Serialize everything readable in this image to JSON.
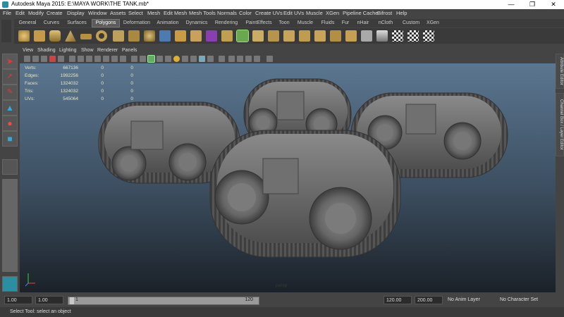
{
  "window": {
    "title": "Autodesk Maya 2015: E:\\MAYA WORK\\THE TANK.mb*"
  },
  "menubar": [
    "File",
    "Edit",
    "Modify",
    "Create",
    "Display",
    "Window",
    "Assets",
    "Select",
    "Mesh",
    "Edit Mesh",
    "Mesh Tools",
    "Normals",
    "Color",
    "Create UVs",
    "Edit UVs",
    "Muscle",
    "XGen",
    "Pipeline Cache",
    "Bifrost",
    "Help"
  ],
  "shelf_tabs": [
    "General",
    "Curves",
    "Surfaces",
    "Polygons",
    "Deformation",
    "Animation",
    "Dynamics",
    "Rendering",
    "PaintEffects",
    "Toon",
    "Muscle",
    "Fluids",
    "Fur",
    "nHair",
    "nCloth",
    "Custom",
    "XGen"
  ],
  "active_shelf_tab": "Polygons",
  "panel_menu": [
    "View",
    "Shading",
    "Lighting",
    "Show",
    "Renderer",
    "Panels"
  ],
  "hud": {
    "rows": [
      {
        "label": "Verts:",
        "v1": "667136",
        "v2": "0",
        "v3": "0"
      },
      {
        "label": "Edges:",
        "v1": "1992256",
        "v2": "0",
        "v3": "0"
      },
      {
        "label": "Faces:",
        "v1": "1324032",
        "v2": "0",
        "v3": "0"
      },
      {
        "label": "Tris:",
        "v1": "1324032",
        "v2": "0",
        "v3": "0"
      },
      {
        "label": "UVs:",
        "v1": "545064",
        "v2": "0",
        "v3": "0"
      }
    ]
  },
  "camera_label": "persp",
  "right_tabs": {
    "attribute_editor": "Attribute Editor",
    "channel_box": "Channel Box / Layer Editor"
  },
  "timeline": {
    "start_field": "1.00",
    "current_field": "1.00",
    "range_start_label": "1",
    "range_end_label": "120",
    "end_field": "120.00",
    "anim_end_field": "200.00",
    "anim_layer": "No Anim Layer",
    "character_set": "No Character Set"
  },
  "status": "Select Tool: select an object",
  "colors": {
    "viewport_top": "#5b7690",
    "viewport_bottom": "#1b2128",
    "hud_text": "#e8e8c0",
    "accent_select": "#3aa0c0"
  }
}
